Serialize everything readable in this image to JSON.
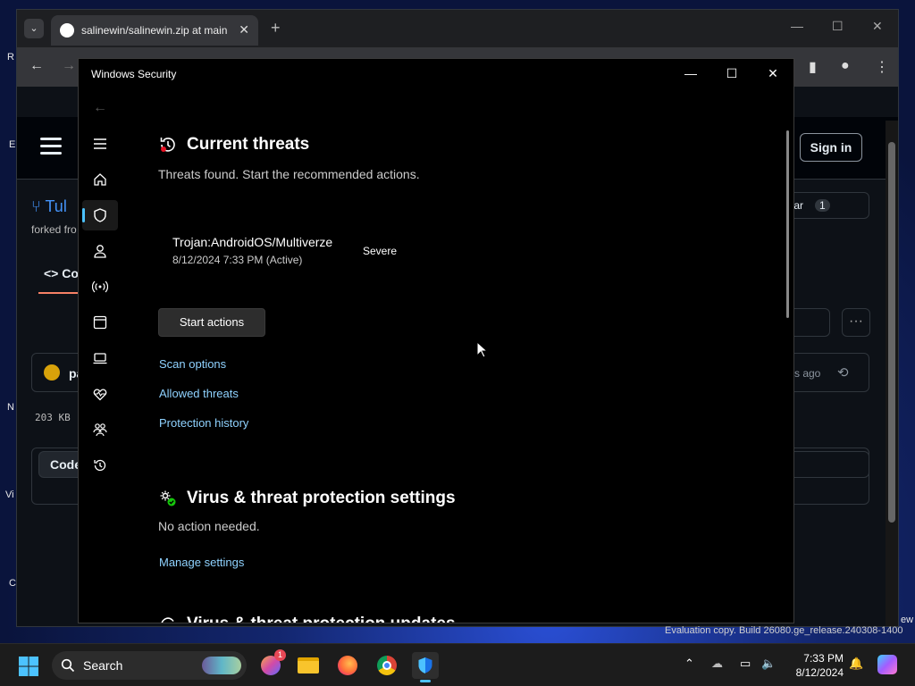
{
  "browser": {
    "tab_title": "salinewin/salinewin.zip at main",
    "tab_close": "✕",
    "new_tab": "+",
    "win_min": "—",
    "win_max": "☐",
    "win_close": "✕",
    "back": "←",
    "forward": "→"
  },
  "github": {
    "sign_in": "Sign in",
    "repo_name_fragment": "Tul",
    "forked_fragment": "forked fro",
    "code_tab_fragment": "Co",
    "star_fragment": "tar",
    "star_count": "1",
    "commit_user_fragment": "pa",
    "time_fragment": "rs ago",
    "file_size": "203 KB",
    "code_btn_fragment": "Code"
  },
  "desktop": {
    "frags": [
      "R",
      "E",
      "N",
      "Vi",
      "C",
      "ew"
    ]
  },
  "security": {
    "window_title": "Windows Security",
    "current_threats": {
      "heading": "Current threats",
      "subtitle": "Threats found. Start the recommended actions.",
      "threat": {
        "name": "Trojan:AndroidOS/Multiverze",
        "date": "8/12/2024 7:33 PM (Active)",
        "severity": "Severe"
      },
      "start_actions": "Start actions",
      "links": {
        "scan_options": "Scan options",
        "allowed_threats": "Allowed threats",
        "protection_history": "Protection history"
      }
    },
    "settings": {
      "heading": "Virus & threat protection settings",
      "subtitle": "No action needed.",
      "manage": "Manage settings"
    },
    "next_section_fragment": "Virus & threat protection updates",
    "nav_icons": [
      "menu-icon",
      "home-icon",
      "shield-icon",
      "account-icon",
      "network-icon",
      "app-browser-icon",
      "device-security-icon",
      "health-icon",
      "family-icon",
      "history-icon",
      "settings-icon"
    ]
  },
  "watermark": "Evaluation copy. Build 26080.ge_release.240308-1400",
  "taskbar": {
    "search_label": "Search",
    "notification_badge": "1",
    "clock_time": "7:33 PM",
    "clock_date": "8/12/2024"
  },
  "colors": {
    "accent": "#4cc2ff",
    "link": "#8fd2ff",
    "threat_red": "#e81123"
  }
}
